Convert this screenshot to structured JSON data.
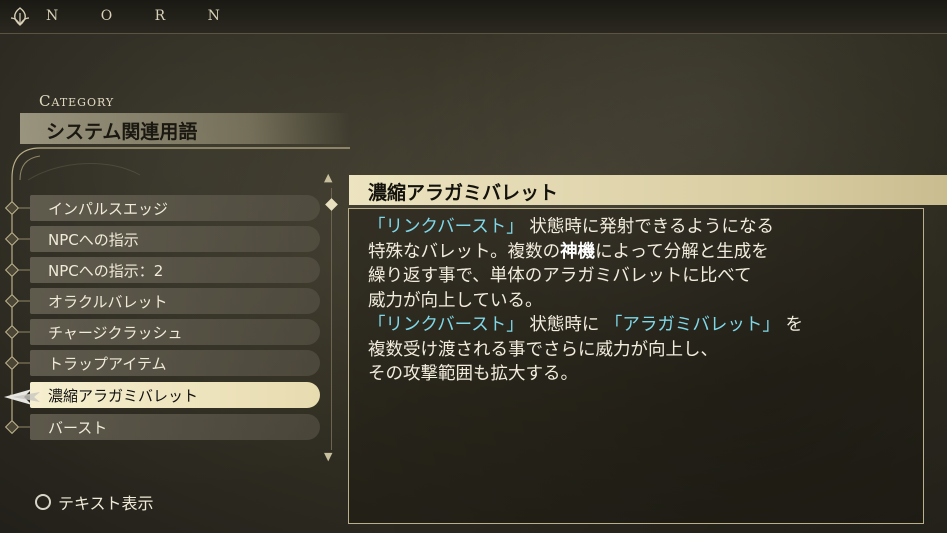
{
  "header": {
    "logo_icon": "leaf-emblem-icon",
    "title": "N O R N"
  },
  "category": {
    "label": "Category",
    "value": "システム関連用語"
  },
  "list": {
    "items": [
      {
        "label": "インパルスエッジ",
        "selected": false
      },
      {
        "label": "NPCへの指示",
        "selected": false
      },
      {
        "label": "NPCへの指示：2",
        "selected": false
      },
      {
        "label": "オラクルバレット",
        "selected": false
      },
      {
        "label": "チャージクラッシュ",
        "selected": false
      },
      {
        "label": "トラップアイテム",
        "selected": false
      },
      {
        "label": "濃縮アラガミバレット",
        "selected": true
      },
      {
        "label": "バースト",
        "selected": false
      }
    ]
  },
  "detail": {
    "title": "濃縮アラガミバレット",
    "lines": [
      [
        {
          "t": "「リンクバースト」",
          "hl": true
        },
        {
          "t": " 状態時に発射できるようになる"
        }
      ],
      [
        {
          "t": "特殊なバレット。複数の"
        },
        {
          "t": "神機",
          "bold": true
        },
        {
          "t": "によって分解と生成を"
        }
      ],
      [
        {
          "t": "繰り返す事で、単体のアラガミバレットに比べて"
        }
      ],
      [
        {
          "t": "威力が向上している。"
        }
      ],
      [
        {
          "t": "「リンクバースト」",
          "hl": true
        },
        {
          "t": " 状態時に "
        },
        {
          "t": "「アラガミバレット」",
          "hl": true
        },
        {
          "t": " を"
        }
      ],
      [
        {
          "t": "複数受け渡される事でさらに威力が向上し、"
        }
      ],
      [
        {
          "t": "その攻撃範囲も拡大する。"
        }
      ]
    ]
  },
  "footer": {
    "button_icon": "circle-button-icon",
    "button_label": "テキスト表示"
  },
  "colors": {
    "highlight": "#7fd8e8",
    "selected_bg": "#f6efcf"
  }
}
